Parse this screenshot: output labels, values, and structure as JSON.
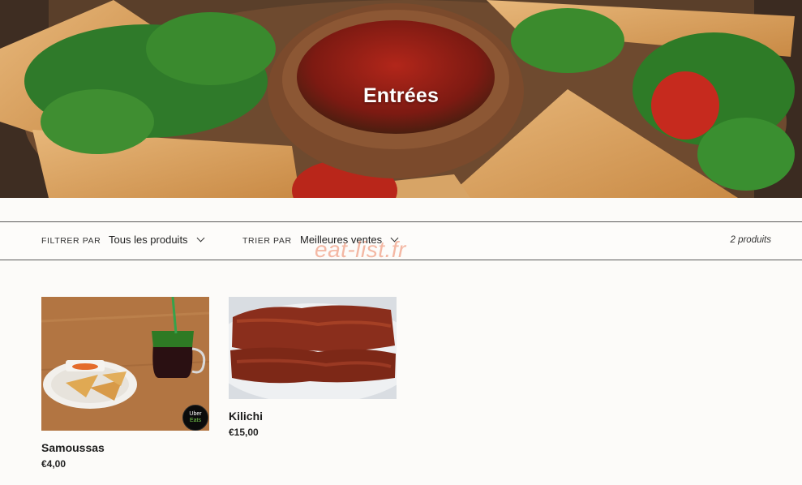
{
  "collection": {
    "title": "Entrées"
  },
  "filter_bar": {
    "filter_label": "FILTRER PAR",
    "filter_value": "Tous les produits",
    "sort_label": "TRIER PAR",
    "sort_value": "Meilleures ventes",
    "product_count": "2 produits"
  },
  "watermark": "eat-list.fr",
  "products": [
    {
      "name": "Samoussas",
      "price": "€4,00",
      "badge_line1": "Uber",
      "badge_line2": "Eats"
    },
    {
      "name": "Kilichi",
      "price": "€15,00"
    }
  ],
  "icons": [
    "chevron-down-icon",
    "chevron-down-icon"
  ]
}
